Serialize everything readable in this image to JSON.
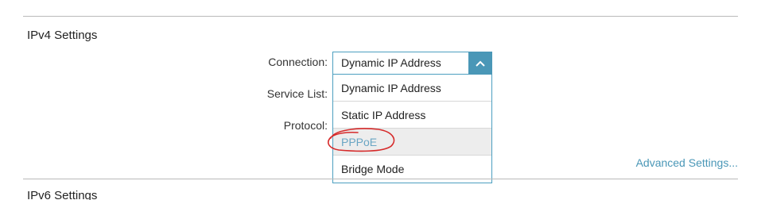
{
  "ipv4": {
    "title": "IPv4 Settings",
    "connection_label": "Connection:",
    "service_list_label": "Service List:",
    "protocol_label": "Protocol:",
    "connection_select": {
      "value": "Dynamic IP Address",
      "options": [
        "Dynamic IP Address",
        "Static IP Address",
        "PPPoE",
        "Bridge Mode"
      ],
      "highlighted_option": "PPPoE"
    },
    "advanced_settings_link": "Advanced Settings..."
  },
  "ipv6": {
    "title": "IPv6 Settings"
  },
  "colors": {
    "accent": "#4a97b7",
    "border": "#4c9fc0",
    "highlight_bg": "#ededed",
    "annotation": "#d62a2a"
  },
  "icons": {
    "select_toggle": "chevron-up-icon"
  }
}
